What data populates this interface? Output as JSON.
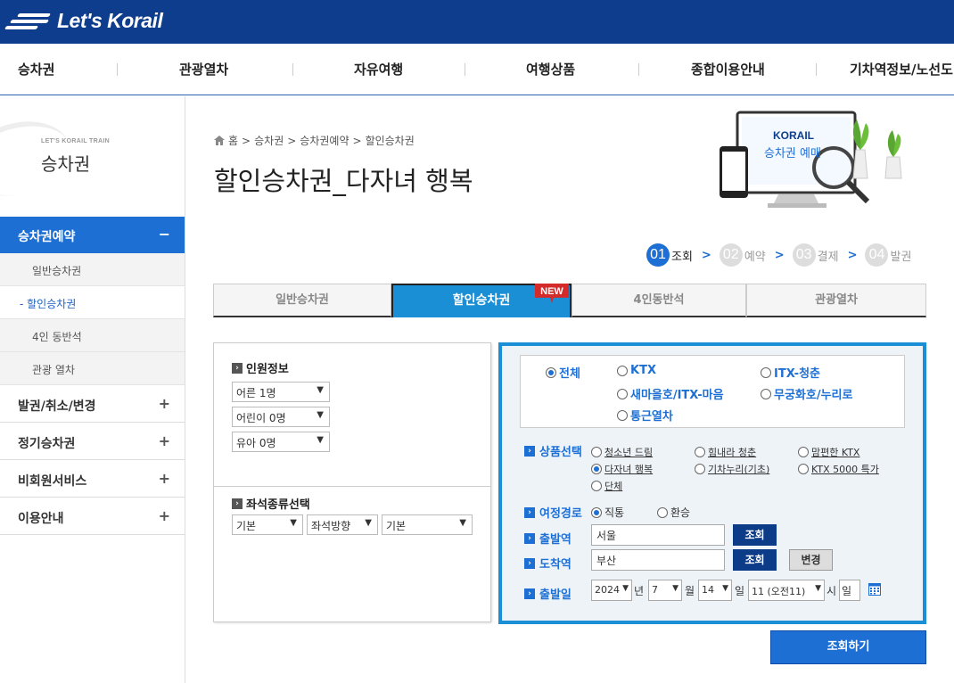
{
  "header": {
    "logo_text": "Let's Korail"
  },
  "gnb": [
    "승차권",
    "관광열차",
    "자유여행",
    "여행상품",
    "종합이용안내",
    "기차역정보/노선도"
  ],
  "lnb": {
    "sub_title": "LET'S KORAIL TRAIN",
    "title": "승차권",
    "active": {
      "label": "승차권예약",
      "toggle": "−"
    },
    "sub_items": [
      "일반승차권",
      "- 할인승차권",
      "4인 동반석",
      "관광 열차"
    ],
    "main_items": [
      {
        "label": "발권/취소/변경",
        "toggle": "+"
      },
      {
        "label": "정기승차권",
        "toggle": "+"
      },
      {
        "label": "비회원서비스",
        "toggle": "+"
      },
      {
        "label": "이용안내",
        "toggle": "+"
      }
    ]
  },
  "breadcrumb": [
    "홈",
    ">",
    "승차권",
    ">",
    "승차권예약",
    ">",
    "할인승차권"
  ],
  "page_title": "할인승차권_다자녀 행복",
  "banner": {
    "brand": "KORAIL",
    "text": "승차권 예매"
  },
  "steps": [
    {
      "num": "01",
      "label": "조회",
      "arrow": ">"
    },
    {
      "num": "02",
      "label": "예약",
      "arrow": ">"
    },
    {
      "num": "03",
      "label": "결제",
      "arrow": ">"
    },
    {
      "num": "04",
      "label": "발권",
      "arrow": ""
    }
  ],
  "tabs": [
    "일반승차권",
    "할인승차권",
    "4인동반석",
    "관광열차"
  ],
  "new_badge": "NEW",
  "passenger": {
    "heading": "인원정보",
    "adult": "어른 1명",
    "child": "어린이 0명",
    "infant": "유아 0명"
  },
  "seat": {
    "heading": "좌석종류선택",
    "type": "기본",
    "direction": "좌석방향",
    "option": "기본"
  },
  "train_types": [
    "전체",
    "KTX",
    "ITX-청춘",
    "새마을호/ITX-마음",
    "무궁화호/누리로",
    "통근열차"
  ],
  "product": {
    "label": "상품선택",
    "options": [
      "청소년 드림",
      "힘내라 청춘",
      "맘편한 KTX",
      "다자녀 행복",
      "기차누리(기초)",
      "KTX 5000 특가",
      "단체"
    ]
  },
  "route": {
    "label": "여정경로",
    "options": [
      "직통",
      "환승"
    ]
  },
  "departure": {
    "label": "출발역",
    "value": "서울",
    "button": "조회"
  },
  "arrival": {
    "label": "도착역",
    "value": "부산",
    "button": "조회",
    "swap": "변경"
  },
  "date": {
    "label": "출발일",
    "year": "2024",
    "year_unit": "년",
    "month": "7",
    "month_unit": "월",
    "day": "14",
    "day_unit": "일",
    "hour": "11 (오전11)",
    "hour_unit": "시",
    "weekday": "일"
  },
  "search_button": "조회하기",
  "colors": {
    "brand_navy": "#0d3d8c",
    "accent_blue": "#1e6fd4",
    "tab_blue": "#1a8fd6",
    "badge_red": "#d42a2a"
  }
}
